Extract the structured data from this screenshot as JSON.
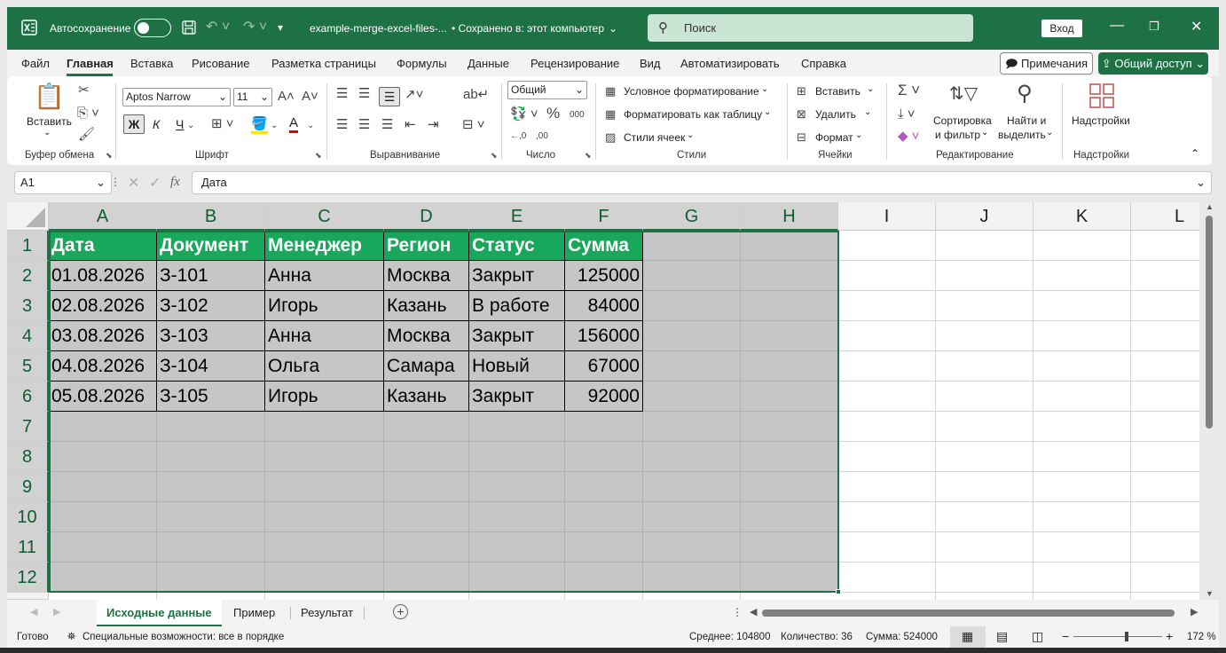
{
  "titlebar": {
    "autosave_label": "Автосохранение",
    "doc_title": "example-merge-excel-files-...",
    "save_status": "• Сохранено в: этот компьютер",
    "search_placeholder": "Поиск",
    "login_label": "Вход"
  },
  "menu": {
    "items": [
      "Файл",
      "Главная",
      "Вставка",
      "Рисование",
      "Разметка страницы",
      "Формулы",
      "Данные",
      "Рецензирование",
      "Вид",
      "Автоматизировать",
      "Справка"
    ],
    "active": "Главная",
    "notes_label": "Примечания",
    "share_label": "Общий доступ"
  },
  "ribbon": {
    "clipboard": {
      "paste_label": "Вставить",
      "group_label": "Буфер обмена"
    },
    "font": {
      "font_name": "Aptos Narrow",
      "font_size": "11",
      "bold": "Ж",
      "italic": "К",
      "underline": "Ч",
      "group_label": "Шрифт"
    },
    "alignment": {
      "group_label": "Выравнивание"
    },
    "number": {
      "format": "Общий",
      "group_label": "Число"
    },
    "styles": {
      "conditional": "Условное форматирование",
      "as_table": "Форматировать как таблицу",
      "cell_styles": "Стили ячеек",
      "group_label": "Стили"
    },
    "cells": {
      "insert": "Вставить",
      "delete": "Удалить",
      "format": "Формат",
      "group_label": "Ячейки"
    },
    "editing": {
      "sort_l1": "Сортировка",
      "sort_l2": "и фильтр",
      "find_l1": "Найти и",
      "find_l2": "выделить",
      "group_label": "Редактирование"
    },
    "addins": {
      "label": "Надстройки",
      "group_label": "Надстройки"
    }
  },
  "formula_bar": {
    "name_box": "A1",
    "fx": "fx",
    "content": "Дата"
  },
  "grid": {
    "columns": [
      "A",
      "B",
      "C",
      "D",
      "E",
      "F",
      "G",
      "H",
      "I",
      "J",
      "K",
      "L"
    ],
    "rows": [
      "1",
      "2",
      "3",
      "4",
      "5",
      "6",
      "7",
      "8",
      "9",
      "10",
      "11",
      "12"
    ],
    "header": [
      "Дата",
      "Документ",
      "Менеджер",
      "Регион",
      "Статус",
      "Сумма"
    ],
    "data": [
      [
        "01.08.2026",
        "З-101",
        "Анна",
        "Москва",
        "Закрыт",
        "125000"
      ],
      [
        "02.08.2026",
        "З-102",
        "Игорь",
        "Казань",
        "В работе",
        "84000"
      ],
      [
        "03.08.2026",
        "З-103",
        "Анна",
        "Москва",
        "Закрыт",
        "156000"
      ],
      [
        "04.08.2026",
        "З-104",
        "Ольга",
        "Самара",
        "Новый",
        "67000"
      ],
      [
        "05.08.2026",
        "З-105",
        "Игорь",
        "Казань",
        "Закрыт",
        "92000"
      ]
    ]
  },
  "sheets": {
    "tabs": [
      "Исходные данные",
      "Пример",
      "Результат"
    ],
    "active": "Исходные данные"
  },
  "statusbar": {
    "ready": "Готово",
    "accessibility": "Специальные возможности: все в порядке",
    "average": "Среднее: 104800",
    "count": "Количество: 36",
    "sum": "Сумма: 524000",
    "zoom": "172 %"
  }
}
